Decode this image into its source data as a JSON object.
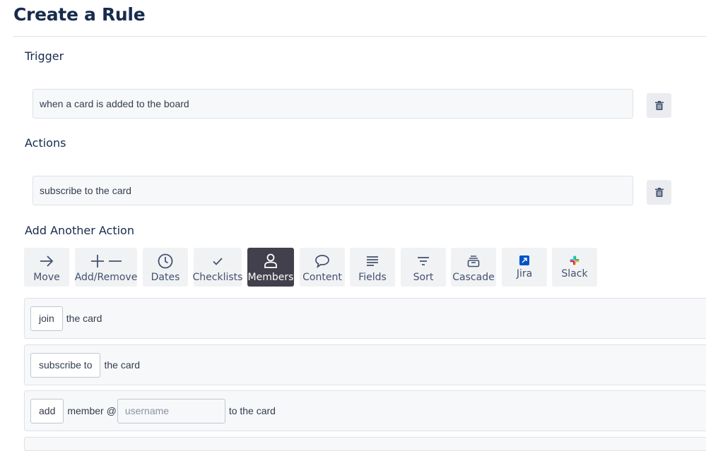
{
  "page": {
    "title": "Create a Rule"
  },
  "trigger": {
    "heading": "Trigger",
    "text": "when a card is added to the board"
  },
  "actions": {
    "heading": "Actions",
    "items": [
      {
        "text": "subscribe to the card"
      }
    ]
  },
  "add_action": {
    "heading": "Add Another Action",
    "tabs": [
      {
        "label": "Move",
        "icon": "arrow-right-icon"
      },
      {
        "label": "Add/Remove",
        "icon": "plus-minus-icon"
      },
      {
        "label": "Dates",
        "icon": "clock-icon"
      },
      {
        "label": "Checklists",
        "icon": "checkmark-icon"
      },
      {
        "label": "Members",
        "icon": "person-icon",
        "active": true
      },
      {
        "label": "Content",
        "icon": "speech-bubble-icon"
      },
      {
        "label": "Fields",
        "icon": "lines-icon"
      },
      {
        "label": "Sort",
        "icon": "filter-icon"
      },
      {
        "label": "Cascade",
        "icon": "stack-icon"
      },
      {
        "label": "Jira",
        "icon": "jira-icon"
      },
      {
        "label": "Slack",
        "icon": "slack-icon"
      }
    ]
  },
  "options": [
    {
      "button": "join",
      "text": "the card"
    },
    {
      "button": "subscribe to",
      "text": "the card"
    },
    {
      "button": "add",
      "text_before": "member @",
      "input_placeholder": "username",
      "text_after": "to the card"
    }
  ],
  "colors": {
    "active_tab": "#41404c",
    "tab_bg": "#f1f2f4",
    "jira_blue": "#0052cc"
  }
}
